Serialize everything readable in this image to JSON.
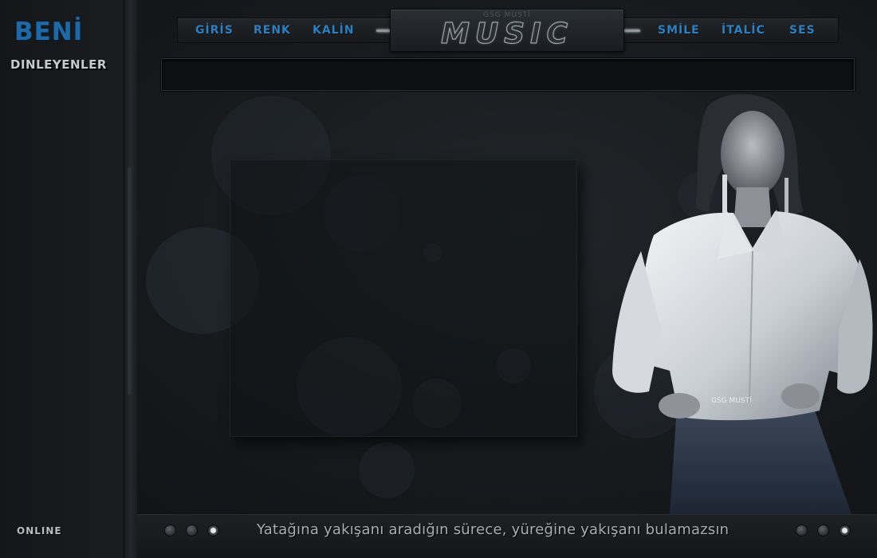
{
  "sidebar": {
    "title": "BENİ",
    "subtitle": "DINLEYENLER",
    "status": "ONLINE"
  },
  "nav": {
    "left": [
      "GİRİS",
      "RENK",
      "KALİN"
    ],
    "right": [
      "SMİLE",
      "İTALİC",
      "SES"
    ]
  },
  "logo": {
    "small": "GSG MUSTİ",
    "title": "MUSIC"
  },
  "figure": {
    "watermark": "GSG MUSTİ"
  },
  "footer": {
    "slogan": "Yatağına yakışanı aradığın sürece, yüreğine yakışanı bulamazsın"
  },
  "colors": {
    "accent": "#2f7fbf",
    "brand": "#1f6aa6",
    "background": "#16181b"
  }
}
